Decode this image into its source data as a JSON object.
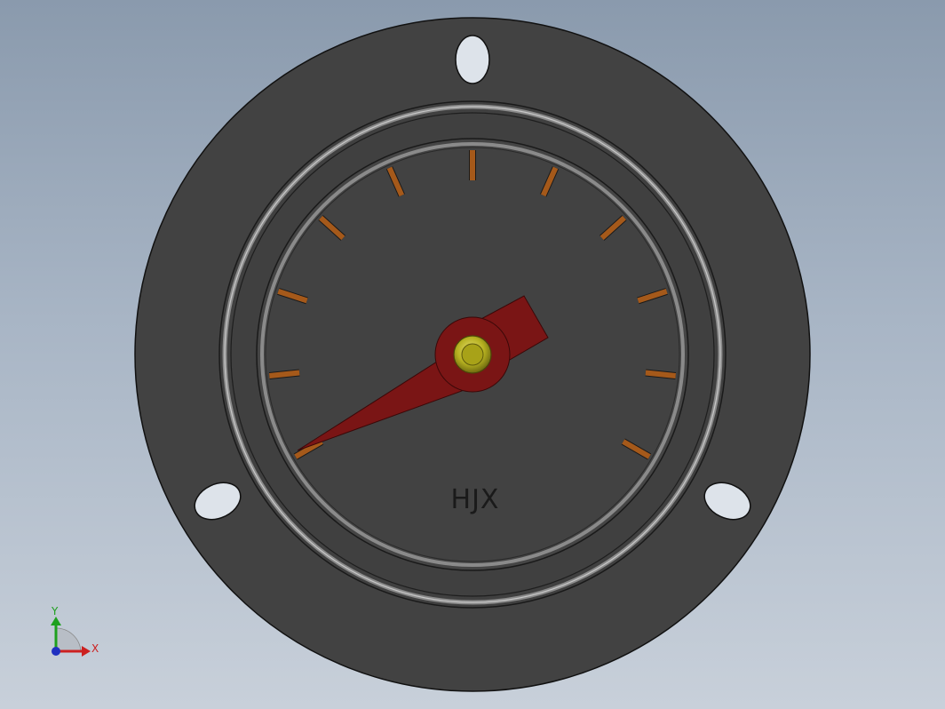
{
  "gauge": {
    "dial_label": "HJX",
    "tick_count": 11,
    "needle_tick_index": 0,
    "colors": {
      "flange": "#424242",
      "bezel": "#404040",
      "tick": "#a5591a",
      "needle": "#7a1515",
      "hub": "#b5b020"
    }
  },
  "triad": {
    "y_label": "Y",
    "x_label": "X",
    "y_color": "#1ea01e",
    "x_color": "#cc2020",
    "z_color": "#2030c0"
  }
}
